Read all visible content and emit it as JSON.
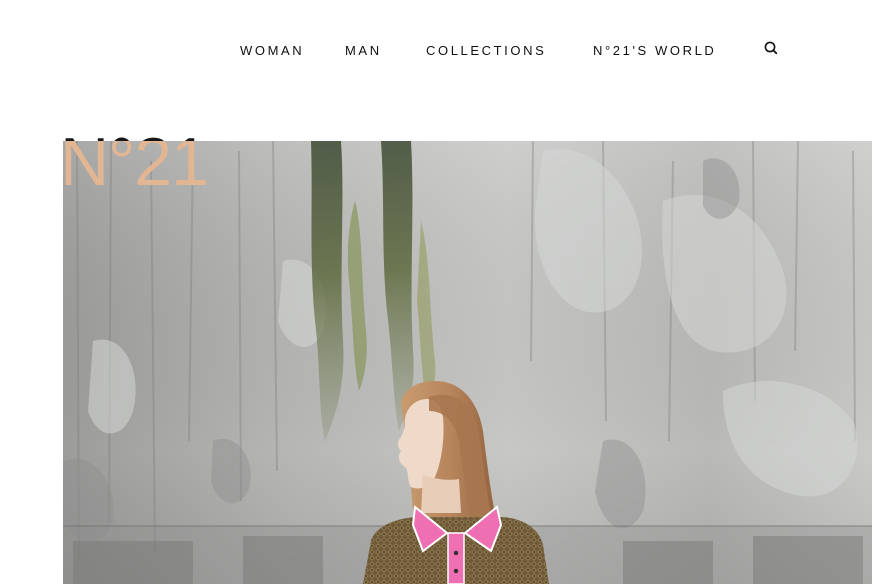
{
  "nav": {
    "items": [
      {
        "label": "WOMAN"
      },
      {
        "label": "MAN"
      },
      {
        "label": "COLLECTIONS"
      },
      {
        "label": "N°21'S WORLD"
      }
    ],
    "search_icon": "search-icon"
  },
  "logo": {
    "text": "N°21"
  },
  "hero": {
    "image": "model-against-concrete-wall",
    "colors": {
      "wall": "#a7a9a8",
      "moss": "#5f6b3f",
      "hair": "#b7855c",
      "collar": "#ef6fb3"
    }
  },
  "colors": {
    "logo_dark": "#151515",
    "logo_light": "#e2b593",
    "nav_text": "#111111"
  }
}
